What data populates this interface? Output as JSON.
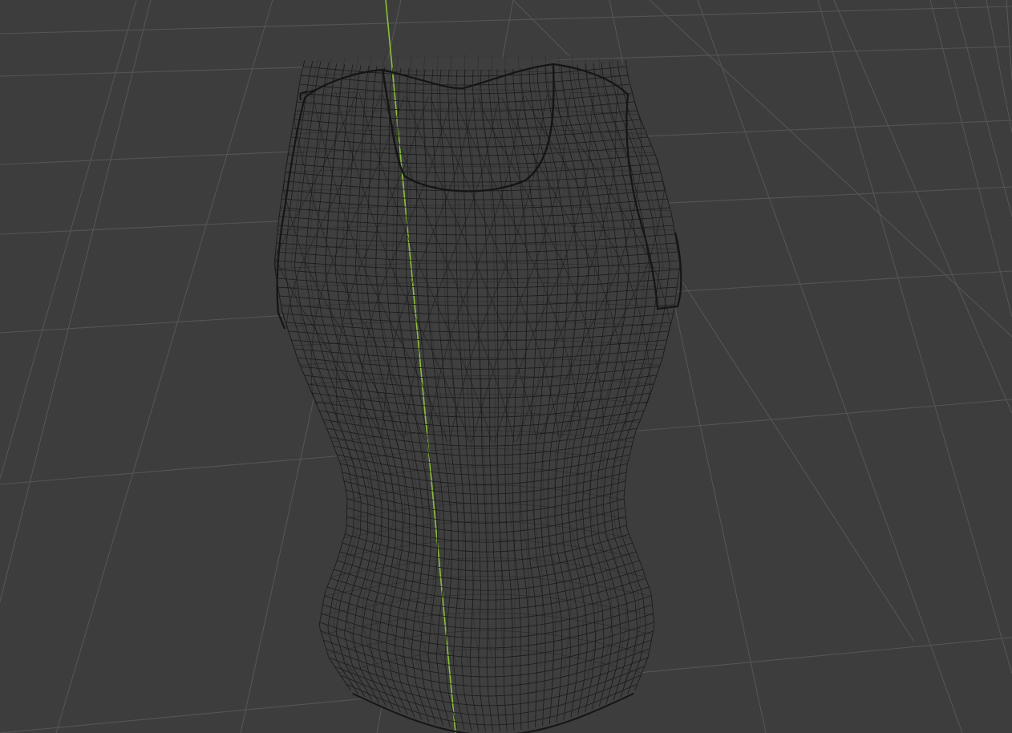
{
  "viewport": {
    "background_color": "#3d3d3d",
    "grid_color": "#555555",
    "y_axis_color": "#8ac03a",
    "wire_color": "#1b1b1b",
    "mesh_object": "sleeveless-top"
  }
}
